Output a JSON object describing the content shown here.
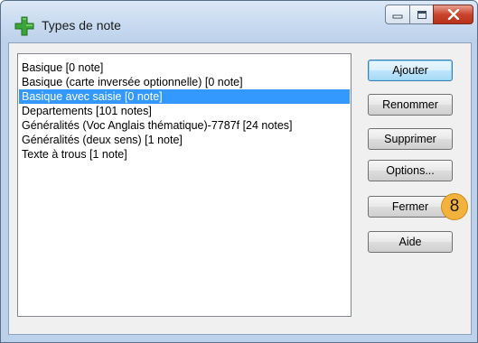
{
  "window": {
    "title": "Types de note"
  },
  "note_types": [
    {
      "label": "Basique [0 note]",
      "selected": false
    },
    {
      "label": "Basique (carte inversée optionnelle) [0 note]",
      "selected": false
    },
    {
      "label": "Basique avec saisie [0 note]",
      "selected": true
    },
    {
      "label": "Departements [101 notes]",
      "selected": false
    },
    {
      "label": "Généralités (Voc Anglais thématique)-7787f [24 notes]",
      "selected": false
    },
    {
      "label": "Généralités (deux sens) [1 note]",
      "selected": false
    },
    {
      "label": "Texte à trous [1 note]",
      "selected": false
    }
  ],
  "buttons": {
    "add": "Ajouter",
    "rename": "Renommer",
    "delete": "Supprimer",
    "options": "Options...",
    "close": "Fermer",
    "help": "Aide"
  },
  "annotation_badge": "8",
  "colors": {
    "selection": "#3399ff",
    "close_button": "#c9442c",
    "badge": "#f2b23c"
  }
}
